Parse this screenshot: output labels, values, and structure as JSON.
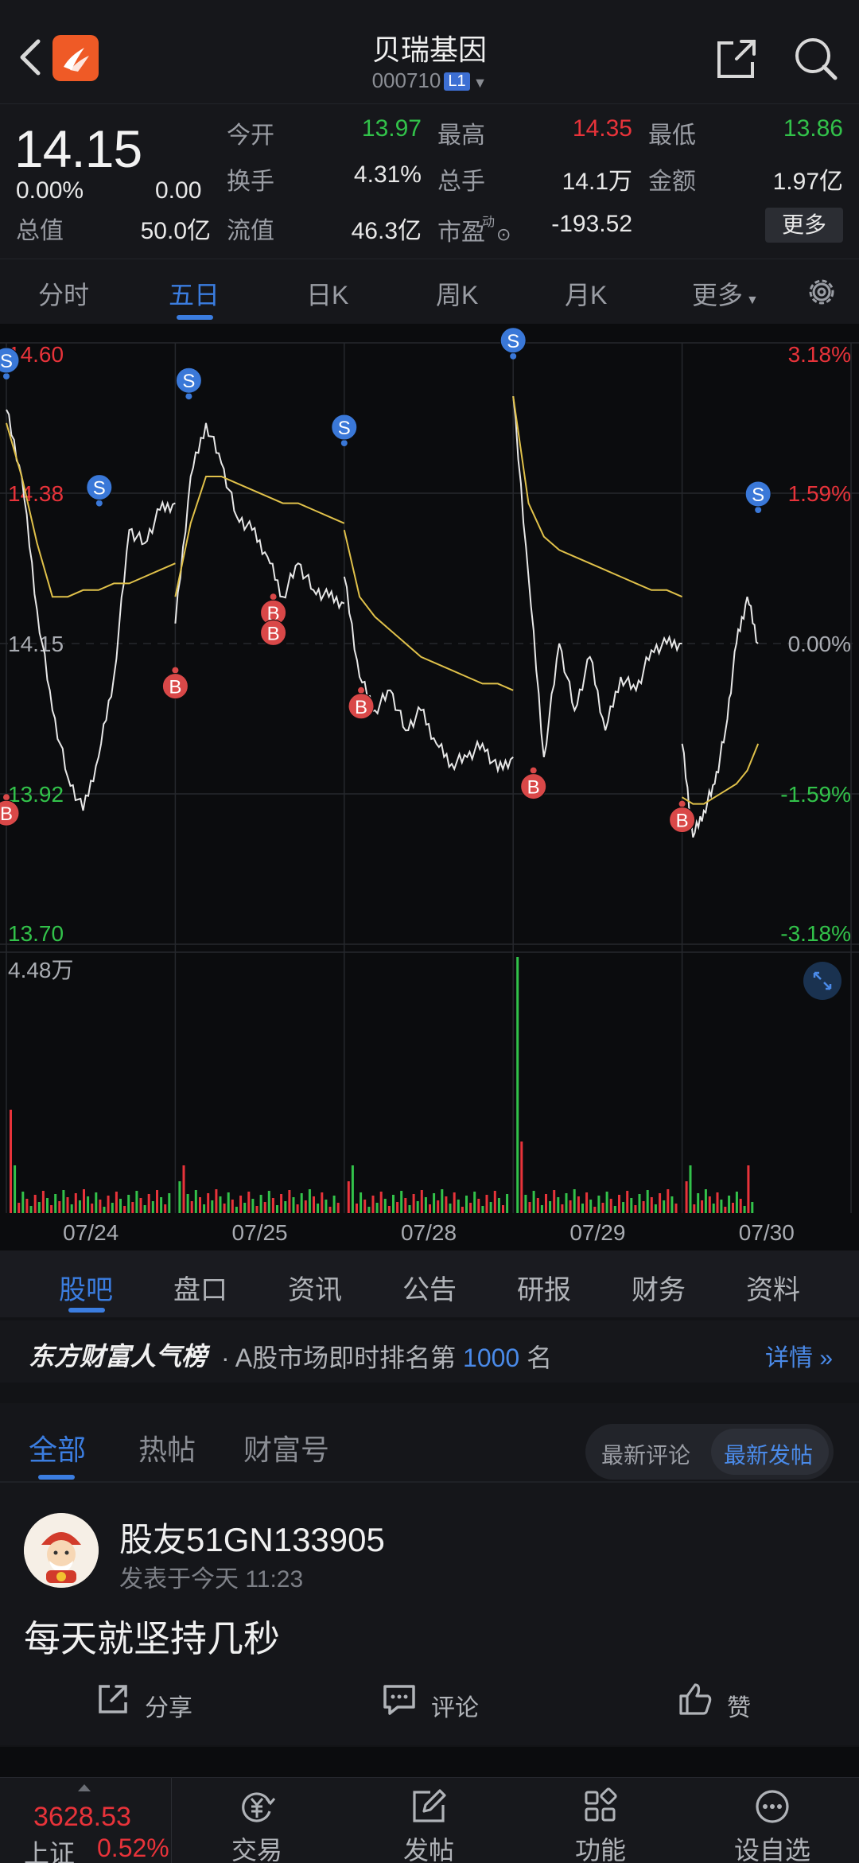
{
  "header": {
    "title": "贝瑞基因",
    "code": "000710",
    "level_badge": "L1"
  },
  "quote": {
    "price": "14.15",
    "change_pct": "0.00%",
    "change_abs": "0.00",
    "total_value_label": "总值",
    "total_value": "50.0亿",
    "fields": [
      {
        "label": "今开",
        "value": "13.97",
        "color": "down"
      },
      {
        "label": "最高",
        "value": "14.35",
        "color": "up"
      },
      {
        "label": "最低",
        "value": "13.86",
        "color": "down"
      },
      {
        "label": "换手",
        "value": "4.31%",
        "color": "neutral"
      },
      {
        "label": "总手",
        "value": "14.1万",
        "color": "neutral"
      },
      {
        "label": "金额",
        "value": "1.97亿",
        "color": "neutral"
      },
      {
        "label": "流值",
        "value": "46.3亿",
        "color": "neutral"
      },
      {
        "label": "市盈",
        "value": "-193.52",
        "color": "neutral"
      }
    ],
    "pe_superscript": "动",
    "more_button": "更多"
  },
  "chart_tabs": {
    "items": [
      "分时",
      "五日",
      "日K",
      "周K",
      "月K",
      "更多"
    ],
    "active": "五日"
  },
  "chart_data": {
    "type": "line",
    "title": "",
    "price_axis": [
      "14.60",
      "14.38",
      "14.15",
      "13.92",
      "13.70"
    ],
    "pct_axis": [
      "3.18%",
      "1.59%",
      "0.00%",
      "-1.59%",
      "-3.18%"
    ],
    "ylim": [
      13.7,
      14.6
    ],
    "prev_close": 14.15,
    "volume_label": "4.48万",
    "x_labels": [
      "07/24",
      "07/25",
      "07/28",
      "07/29",
      "07/30"
    ],
    "days": [
      {
        "date": "07/24",
        "price": [
          14.5,
          14.4,
          14.2,
          14.05,
          13.95,
          13.9,
          13.98,
          14.1,
          14.32,
          14.3,
          14.35,
          14.36
        ],
        "avg": [
          14.48,
          14.4,
          14.3,
          14.22,
          14.22,
          14.23,
          14.23,
          14.24,
          14.24,
          14.25,
          14.26,
          14.27
        ]
      },
      {
        "date": "07/25",
        "price": [
          14.18,
          14.4,
          14.48,
          14.42,
          14.34,
          14.32,
          14.28,
          14.22,
          14.27,
          14.23,
          14.22,
          14.21
        ],
        "avg": [
          14.22,
          14.33,
          14.4,
          14.4,
          14.39,
          14.38,
          14.37,
          14.36,
          14.36,
          14.35,
          14.34,
          14.33
        ]
      },
      {
        "date": "07/28",
        "price": [
          14.25,
          14.1,
          14.05,
          14.08,
          14.02,
          14.05,
          14.0,
          13.97,
          13.98,
          14.0,
          13.96,
          13.98
        ],
        "avg": [
          14.32,
          14.22,
          14.19,
          14.17,
          14.15,
          14.13,
          14.12,
          14.11,
          14.1,
          14.09,
          14.09,
          14.08
        ]
      },
      {
        "date": "07/29",
        "price": [
          14.52,
          14.25,
          13.98,
          14.15,
          14.05,
          14.13,
          14.02,
          14.1,
          14.08,
          14.14,
          14.15,
          14.15
        ],
        "avg": [
          14.52,
          14.36,
          14.31,
          14.29,
          14.28,
          14.27,
          14.26,
          14.25,
          14.24,
          14.23,
          14.23,
          14.22
        ]
      },
      {
        "date": "07/30",
        "price": [
          14.0,
          13.86,
          13.9,
          13.94,
          14.02,
          14.15,
          14.22,
          14.15
        ],
        "avg": [
          13.92,
          13.91,
          13.91,
          13.92,
          13.93,
          13.94,
          13.96,
          14.0
        ]
      }
    ],
    "signals": [
      {
        "type": "S",
        "day": 0,
        "price": 14.55
      },
      {
        "type": "B",
        "day": 0,
        "price": 13.92
      },
      {
        "type": "S",
        "day": 0.55,
        "price": 14.36
      },
      {
        "type": "S",
        "day": 1.08,
        "price": 14.52
      },
      {
        "type": "B",
        "day": 1.0,
        "price": 14.11
      },
      {
        "type": "B",
        "day": 1.58,
        "price": 14.22
      },
      {
        "type": "B",
        "day": 1.58,
        "price": 14.19
      },
      {
        "type": "S",
        "day": 2.0,
        "price": 14.45
      },
      {
        "type": "B",
        "day": 2.1,
        "price": 14.08
      },
      {
        "type": "S",
        "day": 3.0,
        "price": 14.58
      },
      {
        "type": "B",
        "day": 3.12,
        "price": 13.96
      },
      {
        "type": "B",
        "day": 4.0,
        "price": 13.91
      },
      {
        "type": "S",
        "day": 4.45,
        "price": 14.35
      }
    ]
  },
  "sub_tabs": {
    "items": [
      "股吧",
      "盘口",
      "资讯",
      "公告",
      "研报",
      "财务",
      "资料"
    ],
    "active": "股吧"
  },
  "ranking": {
    "brand": "东方财富人气榜",
    "text_prefix": "· A股市场即时排名第 ",
    "rank": "1000",
    "text_suffix": " 名",
    "detail_link": "详情"
  },
  "forum": {
    "tabs": [
      "全部",
      "热帖",
      "财富号"
    ],
    "active_tab": "全部",
    "sort_options": [
      "最新评论",
      "最新发帖"
    ],
    "active_sort": "最新发帖"
  },
  "post": {
    "username": "股友51GN133905",
    "time": "发表于今天 11:23",
    "body": "每天就坚持几秒",
    "actions": {
      "share": "分享",
      "comment": "评论",
      "like": "赞"
    }
  },
  "bottom_bar": {
    "index_price": "3628.53",
    "index_name": "上证",
    "index_pct": "0.52%",
    "nav": [
      "交易",
      "发帖",
      "功能",
      "设自选"
    ]
  },
  "colors": {
    "up": "#e8333a",
    "down": "#32c24a",
    "accent": "#3b7de0",
    "price_line": "#e8e8e8",
    "avg_line": "#e0c14a",
    "sell_marker": "#3a78d8",
    "buy_marker": "#d94848"
  }
}
